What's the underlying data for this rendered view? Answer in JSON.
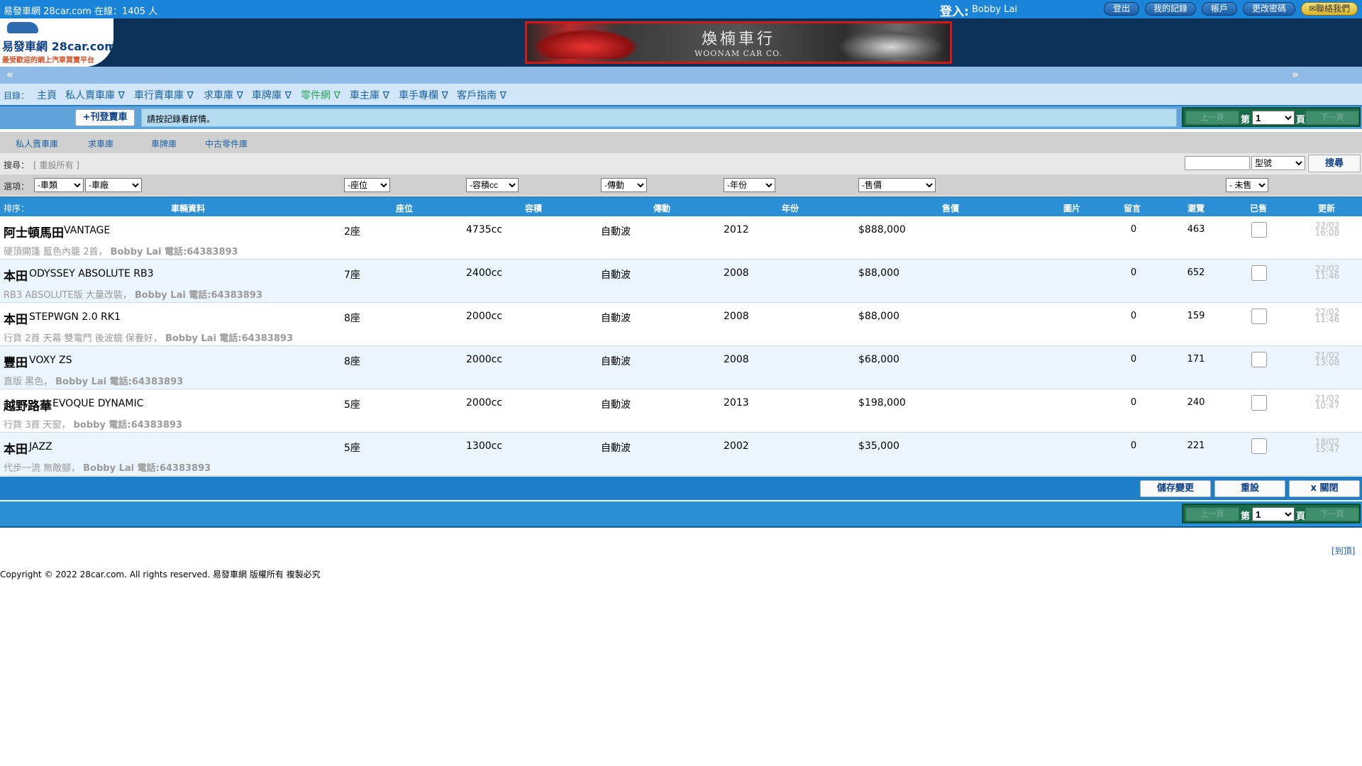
{
  "topbar": {
    "site_info": "易發車網 28car.com 在線：1405 人",
    "login_label": "登入:",
    "login_user": "Bobby Lai",
    "buttons": {
      "logout": "登出",
      "my_records": "我的記錄",
      "account": "帳戶",
      "change_password": "更改密碼",
      "contact_us": "聯絡我們"
    }
  },
  "header": {
    "logo_text": "易發車網 28car.com",
    "logo_slogan": "最受歡迎的網上汽車買賣平台",
    "banner_name_zh": "煥楠車行",
    "banner_name_en": "WOONAM CAR CO."
  },
  "scroll": {
    "prev": "«",
    "next": "»"
  },
  "nav": {
    "label": "目錄：",
    "items": [
      "主頁",
      "私人賣車庫 ∇",
      "車行賣車庫 ∇",
      "求車庫 ∇",
      "車牌庫 ∇",
      "零件網 ∇",
      "車主庫 ∇",
      "車手專欄 ∇",
      "客戶指南 ∇"
    ]
  },
  "actionbar": {
    "add_button": "+刊登賣車",
    "hint": "請按記錄看詳情。",
    "pager": {
      "prev": "上一頁",
      "di": "第",
      "page": "1",
      "ye": "頁",
      "next": "下一頁"
    }
  },
  "subtabs": [
    "私人賣車庫",
    "求車庫",
    "車牌庫",
    "中古零件庫"
  ],
  "search": {
    "label": "搜尋：",
    "reset": "[ 重設所有 ]",
    "input_value": "",
    "select_value": "型號",
    "button": "搜尋"
  },
  "filters": {
    "label": "選項：",
    "type": "-車類",
    "make": "-車廠",
    "seats": "-座位",
    "engine": "-容積cc",
    "transmission": "-傳動",
    "year": "-年份",
    "price": "-售價",
    "sold": "- 未售"
  },
  "table": {
    "sort_label": "排序：",
    "headers": {
      "info": "車輛資料",
      "seats": "座位",
      "engine": "容積",
      "transmission": "傳動",
      "year": "年份",
      "price": "售價",
      "photo": "圖片",
      "comments": "留言",
      "views": "瀏覽",
      "sold": "已售",
      "updated": "更新"
    },
    "rows": [
      {
        "brand": "阿士頓馬田",
        "model": "VANTAGE",
        "seats": "2座",
        "engine": "4735cc",
        "transmission": "自動波",
        "year": "2012",
        "price": "$888,000",
        "comments": "0",
        "views": "463",
        "updated_date": "22/02",
        "updated_time": "16:08",
        "desc": "硬頂開篷 藍色內籠 2首，",
        "dealer": "Bobby Lai 電話:64383893"
      },
      {
        "brand": "本田",
        "model": "ODYSSEY ABSOLUTE RB3",
        "seats": "7座",
        "engine": "2400cc",
        "transmission": "自動波",
        "year": "2008",
        "price": "$88,000",
        "comments": "0",
        "views": "652",
        "updated_date": "22/02",
        "updated_time": "11:46",
        "desc": "RB3 ABSOLUTE版 大量改裝，",
        "dealer": "Bobby Lai 電話:64383893"
      },
      {
        "brand": "本田",
        "model": "STEPWGN 2.0 RK1",
        "seats": "8座",
        "engine": "2000cc",
        "transmission": "自動波",
        "year": "2008",
        "price": "$88,000",
        "comments": "0",
        "views": "159",
        "updated_date": "22/02",
        "updated_time": "11:46",
        "desc": "行貨 2首 天幕 雙電門 後波鏡 保養好，",
        "dealer": "Bobby Lai 電話:64383893"
      },
      {
        "brand": "豐田",
        "model": "VOXY ZS",
        "seats": "8座",
        "engine": "2000cc",
        "transmission": "自動波",
        "year": "2008",
        "price": "$68,000",
        "comments": "0",
        "views": "171",
        "updated_date": "21/02",
        "updated_time": "13:08",
        "desc": "直版 黑色，",
        "dealer": "Bobby Lai 電話:64383893"
      },
      {
        "brand": "越野路華",
        "model": "EVOQUE DYNAMIC",
        "seats": "5座",
        "engine": "2000cc",
        "transmission": "自動波",
        "year": "2013",
        "price": "$198,000",
        "comments": "0",
        "views": "240",
        "updated_date": "21/02",
        "updated_time": "10:47",
        "desc": "行貨 3首 天窗，",
        "dealer": "bobby 電話:64383893"
      },
      {
        "brand": "本田",
        "model": "JAZZ",
        "seats": "5座",
        "engine": "1300cc",
        "transmission": "自動波",
        "year": "2002",
        "price": "$35,000",
        "comments": "0",
        "views": "221",
        "updated_date": "18/02",
        "updated_time": "15:47",
        "desc": "代步一流 無敵腳，",
        "dealer": "Bobby Lai 電話:64383893"
      }
    ]
  },
  "bottom": {
    "save": "儲存變更",
    "reset": "重設",
    "close": "x 關閉"
  },
  "footer": {
    "to_top": "[到頂]",
    "copyright": "Copyright © 2022 28car.com. All rights reserved. 易發車網 版權所有 複製必究"
  }
}
